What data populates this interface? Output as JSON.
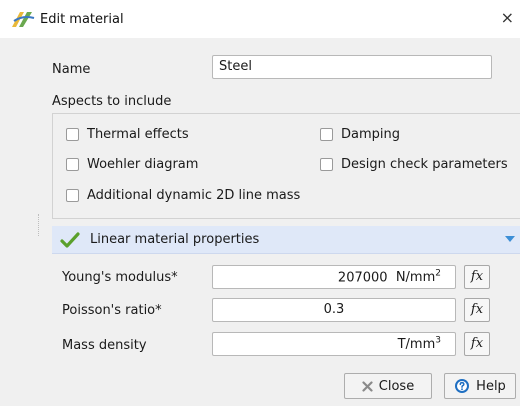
{
  "window": {
    "title": "Edit material",
    "close_glyph": "×",
    "icon": "material-icon"
  },
  "name_field": {
    "label": "Name",
    "value": "Steel"
  },
  "aspects": {
    "heading": "Aspects to include",
    "options": [
      {
        "label": "Thermal effects",
        "checked": false
      },
      {
        "label": "Damping",
        "checked": false
      },
      {
        "label": "Woehler diagram",
        "checked": false
      },
      {
        "label": "Design check parameters",
        "checked": false
      },
      {
        "label": "Additional dynamic 2D line mass",
        "checked": false
      }
    ]
  },
  "section": {
    "title": "Linear material properties",
    "icon": "check-icon",
    "expand_icon": "chevron-down-icon"
  },
  "properties": {
    "youngs": {
      "label": "Young's modulus*",
      "value": "207000",
      "unit_base": "N/mm",
      "unit_exp": "2"
    },
    "poisson": {
      "label": "Poisson's ratio*",
      "value": "0.3"
    },
    "density": {
      "label": "Mass density",
      "value": "",
      "unit_base": "T/mm",
      "unit_exp": "3"
    },
    "fx_label": "fx"
  },
  "buttons": {
    "close": "Close",
    "help": "Help"
  },
  "colors": {
    "section_bg": "#dfe8f8",
    "check_green": "#5aa02c",
    "chevron_blue": "#3d8fd6",
    "help_blue": "#1f6fc2"
  }
}
